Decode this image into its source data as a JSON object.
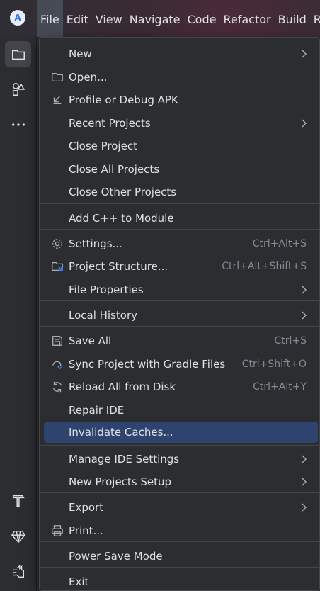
{
  "menubar": {
    "items": [
      "File",
      "Edit",
      "View",
      "Navigate",
      "Code",
      "Refactor",
      "Build",
      "Ru"
    ],
    "active": "File"
  },
  "toolstrip": {
    "top": [
      "project-folder-icon",
      "shapes-icon",
      "more-icon"
    ],
    "bottom": [
      "hammer-icon",
      "gem-icon",
      "cat-icon"
    ]
  },
  "file_menu": {
    "new": "New",
    "open": "Open...",
    "profile_debug_apk": "Profile or Debug APK",
    "recent_projects": "Recent Projects",
    "close_project": "Close Project",
    "close_all_projects": "Close All Projects",
    "close_other_projects": "Close Other Projects",
    "add_cpp_module": "Add C++ to Module",
    "settings": "Settings...",
    "settings_shortcut": "Ctrl+Alt+S",
    "project_structure": "Project Structure...",
    "project_structure_shortcut": "Ctrl+Alt+Shift+S",
    "file_properties": "File Properties",
    "local_history": "Local History",
    "save_all": "Save All",
    "save_all_shortcut": "Ctrl+S",
    "sync_gradle": "Sync Project with Gradle Files",
    "sync_gradle_shortcut": "Ctrl+Shift+O",
    "reload_disk": "Reload All from Disk",
    "reload_disk_shortcut": "Ctrl+Alt+Y",
    "repair_ide": "Repair IDE",
    "invalidate_caches": "Invalidate Caches...",
    "manage_ide_settings": "Manage IDE Settings",
    "new_projects_setup": "New Projects Setup",
    "export": "Export",
    "print": "Print...",
    "power_save_mode": "Power Save Mode",
    "exit": "Exit"
  },
  "colors": {
    "menu_bg": "#2b2d30",
    "highlight": "#2e436e",
    "text": "#dfe1e5",
    "shortcut": "#868a91",
    "accent": "#3574f0"
  }
}
